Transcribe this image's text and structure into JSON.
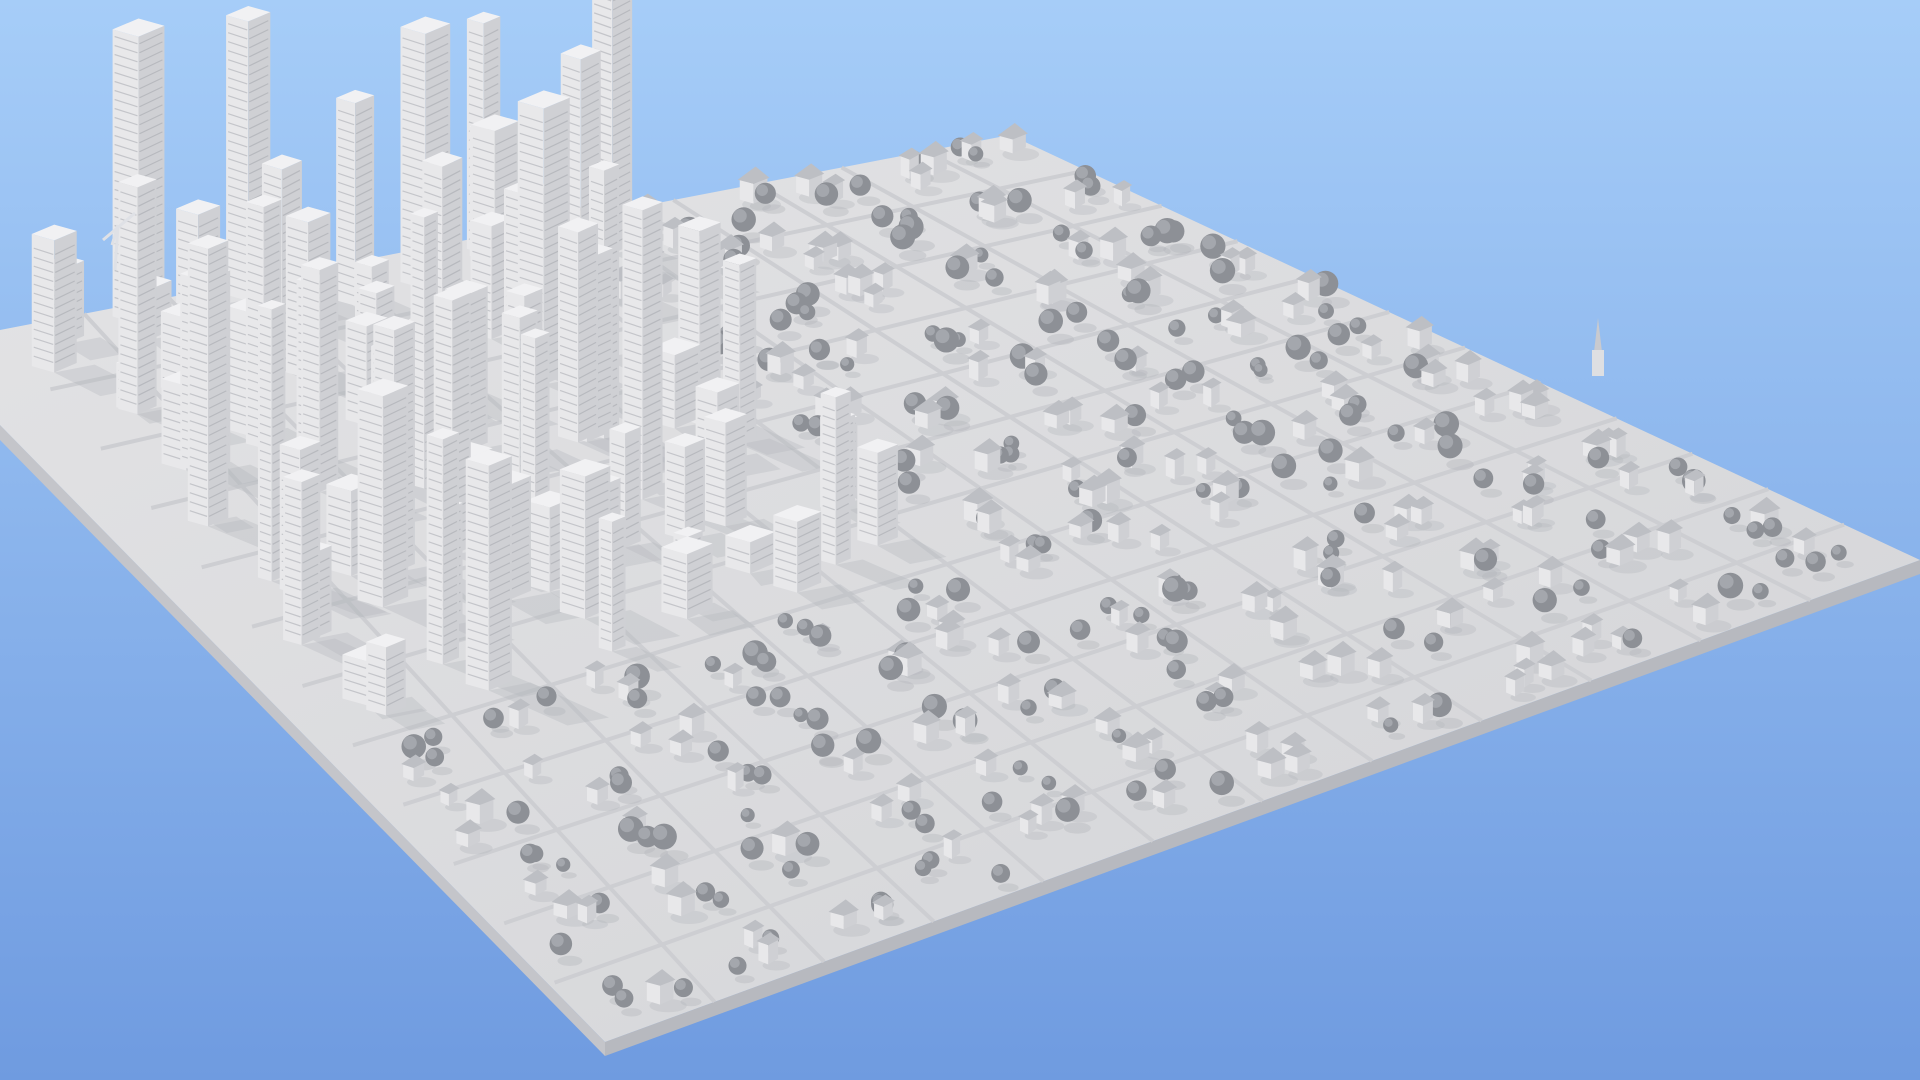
{
  "image": {
    "subject": "clay-render-city-block",
    "background_top_color": "#a6cdf8",
    "background_bottom_color": "#6f9be0",
    "ground_color": "#dcdcde",
    "ground_edge_color": "#c4c5ca",
    "building_light_color": "#e8e8ea",
    "building_mid_color": "#cfd0d4",
    "building_dark_color": "#a8aab0",
    "tree_color": "#8d9096",
    "shadow_color": "#b4b6bc",
    "icons": [
      "tower-crane-icon",
      "church-spire-icon"
    ]
  }
}
